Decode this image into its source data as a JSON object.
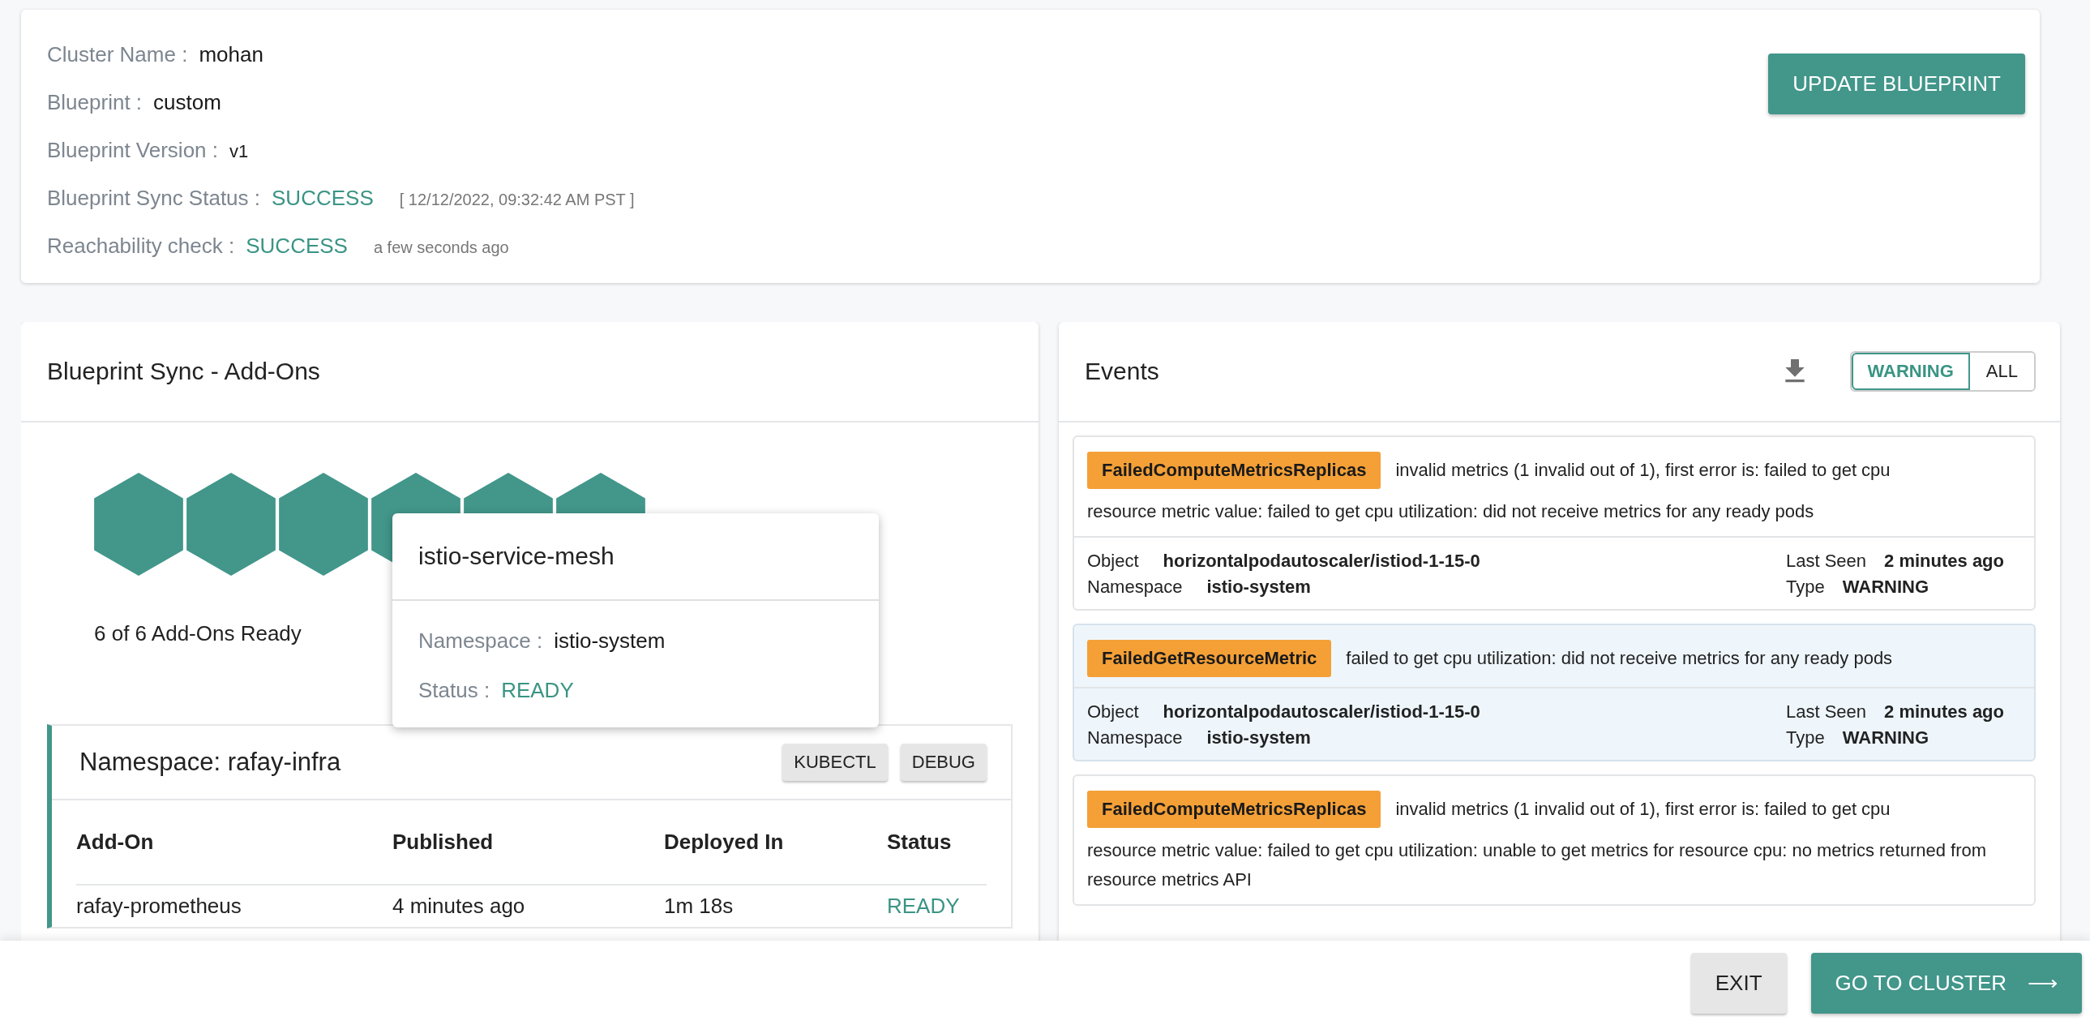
{
  "summary": {
    "fields": [
      {
        "label": "Cluster Name :",
        "value": "mohan",
        "kind": "plain"
      },
      {
        "label": "Blueprint :",
        "value": "custom",
        "kind": "plain"
      },
      {
        "label": "Blueprint Version :",
        "value": "v1",
        "kind": "small"
      },
      {
        "label": "Blueprint Sync Status :",
        "value": "SUCCESS",
        "kind": "status",
        "note": "[ 12/12/2022, 09:32:42 AM PST ]"
      },
      {
        "label": "Reachability check :",
        "value": "SUCCESS",
        "kind": "status",
        "note": "a few seconds ago"
      }
    ],
    "button": "UPDATE BLUEPRINT"
  },
  "addons_panel": {
    "title": "Blueprint Sync - Add-Ons",
    "hexagons": [
      {
        "ready": true
      },
      {
        "ready": true
      },
      {
        "ready": true
      },
      {
        "ready": true
      },
      {
        "ready": true
      },
      {
        "ready": true
      }
    ],
    "ready_text": "6 of 6 Add-Ons Ready",
    "tooltip": {
      "title": "istio-service-mesh",
      "namespace_label": "Namespace :",
      "namespace": "istio-system",
      "status_label": "Status :",
      "status": "READY"
    },
    "namespace": {
      "title": "Namespace: rafay-infra",
      "buttons": [
        "KUBECTL",
        "DEBUG"
      ],
      "columns": [
        "Add-On",
        "Published",
        "Deployed In",
        "Status"
      ],
      "rows": [
        [
          "rafay-prometheus",
          "4 minutes ago",
          "1m 18s",
          "READY"
        ]
      ]
    }
  },
  "events_panel": {
    "title": "Events",
    "filters": [
      {
        "label": "WARNING",
        "selected": true
      },
      {
        "label": "ALL",
        "selected": false
      }
    ],
    "events": [
      {
        "reason": "FailedComputeMetricsReplicas",
        "message": [
          "invalid metrics (1 invalid out of 1), first error is: failed to get cpu",
          "resource metric value: failed to get cpu utilization: did not receive metrics for any ready pods"
        ],
        "highlighted": false,
        "details": [
          {
            "label": "Object",
            "value": "horizontalpodautoscaler/istiod-1-15-0"
          },
          {
            "label": "Last Seen",
            "value": "2 minutes ago"
          },
          {
            "label": "Namespace",
            "value": "istio-system"
          },
          {
            "label": "Type",
            "value": "WARNING"
          }
        ]
      },
      {
        "reason": "FailedGetResourceMetric",
        "message": [
          "failed to get cpu utilization: did not receive metrics for any ready pods"
        ],
        "highlighted": true,
        "details": [
          {
            "label": "Object",
            "value": "horizontalpodautoscaler/istiod-1-15-0"
          },
          {
            "label": "Last Seen",
            "value": "2 minutes ago"
          },
          {
            "label": "Namespace",
            "value": "istio-system"
          },
          {
            "label": "Type",
            "value": "WARNING"
          }
        ]
      },
      {
        "reason": "FailedComputeMetricsReplicas",
        "message": [
          "invalid metrics (1 invalid out of 1), first error is: failed to get cpu",
          "resource metric value: failed to get cpu utilization: unable to get metrics for resource cpu: no metrics returned from resource metrics API"
        ],
        "highlighted": false
      }
    ]
  },
  "footer": {
    "exit": "EXIT",
    "go": "GO TO CLUSTER",
    "go_icon": "⟶"
  }
}
